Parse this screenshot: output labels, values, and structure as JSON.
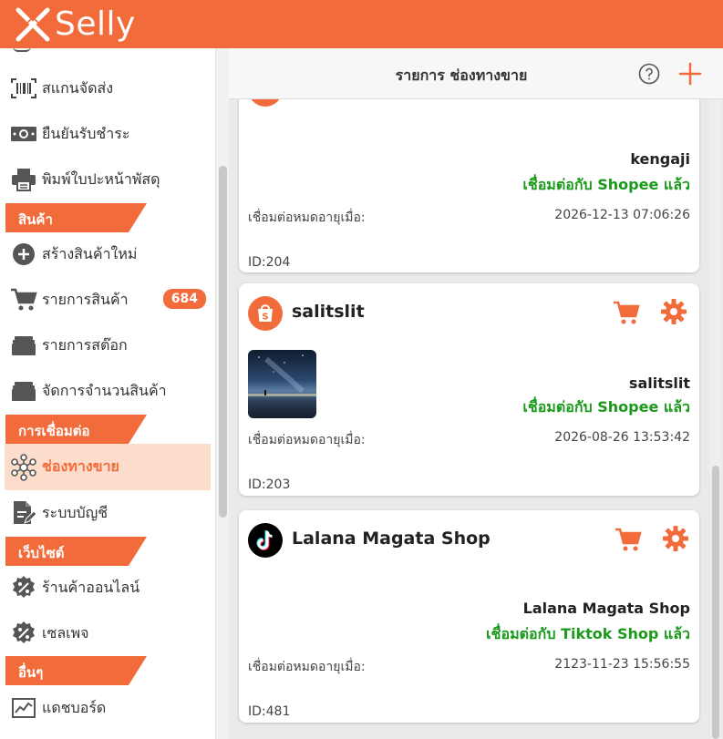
{
  "app": {
    "name": "Selly"
  },
  "sidebar": {
    "items": [
      {
        "label": "สแกนจัดส่ง",
        "icon": "barcode-scan-icon"
      },
      {
        "label": "ยืนยันรับชำระ",
        "icon": "cash-icon"
      },
      {
        "label": "พิมพ์ใบปะหน้าพัสดุ",
        "icon": "printer-icon"
      }
    ],
    "sections": [
      {
        "title": "สินค้า",
        "items": [
          {
            "label": "สร้างสินค้าใหม่",
            "icon": "plus-circle-icon"
          },
          {
            "label": "รายการสินค้า",
            "icon": "cart-icon",
            "badge": "684"
          },
          {
            "label": "รายการสต๊อก",
            "icon": "stack-icon"
          },
          {
            "label": "จัดการจำนวนสินค้า",
            "icon": "stack-icon"
          }
        ]
      },
      {
        "title": "การเชื่อมต่อ",
        "items": [
          {
            "label": "ช่องทางขาย",
            "icon": "network-hub-icon",
            "active": true
          },
          {
            "label": "ระบบบัญชี",
            "icon": "document-edit-icon"
          }
        ]
      },
      {
        "title": "เว็บไซต์",
        "items": [
          {
            "label": "ร้านค้าออนไลน์",
            "icon": "discount-badge-icon"
          },
          {
            "label": "เซลเพจ",
            "icon": "discount-badge-icon"
          }
        ]
      },
      {
        "title": "อื่นๆ",
        "items": [
          {
            "label": "แดชบอร์ด",
            "icon": "chart-line-icon"
          }
        ]
      }
    ]
  },
  "main": {
    "title": "รายการ ช่องทางขาย",
    "cards": [
      {
        "shop_name": "kengaji",
        "status": "เชื่อมต่อกับ Shopee แล้ว",
        "expire_label": "เชื่อมต่อหมดอายุเมื่อ:",
        "expire_value": "2026-12-13 07:06:26",
        "id": "ID:204",
        "platform": "shopee"
      },
      {
        "title": "salitslit",
        "shop_name": "salitslit",
        "status": "เชื่อมต่อกับ Shopee แล้ว",
        "expire_label": "เชื่อมต่อหมดอายุเมื่อ:",
        "expire_value": "2026-08-26 13:53:42",
        "id": "ID:203",
        "platform": "shopee"
      },
      {
        "title": "Lalana Magata Shop",
        "shop_name": "Lalana Magata Shop",
        "status": "เชื่อมต่อกับ Tiktok Shop แล้ว",
        "expire_label": "เชื่อมต่อหมดอายุเมื่อ:",
        "expire_value": "2123-11-23 15:56:55",
        "id": "ID:481",
        "platform": "tiktok"
      }
    ]
  },
  "colors": {
    "brand": "#f26b3a",
    "connected": "#1a9a1a",
    "active_bg": "#fcdccb"
  }
}
